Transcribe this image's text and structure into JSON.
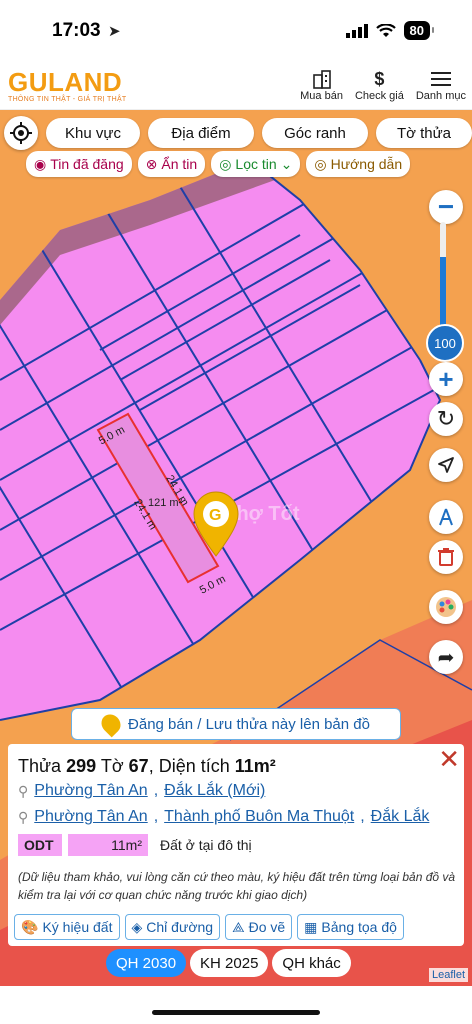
{
  "status": {
    "time": "17:03",
    "battery": "80"
  },
  "header": {
    "logo": "GULAND",
    "tagline": "THÔNG TIN THẬT - GIÁ TRỊ THẬT",
    "nav": [
      {
        "label": "Mua bán",
        "icon": "building-icon"
      },
      {
        "label": "Check giá",
        "icon": "dollar-icon"
      },
      {
        "label": "Danh mục",
        "icon": "menu-icon"
      }
    ]
  },
  "filters": [
    "Khu vực",
    "Địa điểm",
    "Góc ranh",
    "Tờ thửa"
  ],
  "chips": [
    "Tin đã đăng",
    "Ẩn tin",
    "Lọc tin",
    "Hướng dẫn"
  ],
  "map": {
    "zoom": "100",
    "edge_top": "5.0 m",
    "edge_bottom": "5.0 m",
    "edge_right": "24.1 m",
    "edge_left": "24.1 m",
    "area_label": "121 m²",
    "watermark": "Chợ Tốt",
    "colors": {
      "land_pink": "#f58cf0",
      "orange": "#f4a14f",
      "road_red": "#e8534a",
      "grid_blue": "#1e3fa8"
    }
  },
  "banner": "Đăng bán / Lưu thửa này lên bản đồ",
  "panel": {
    "title_prefix": "Thửa",
    "parcel": "299",
    "sheet_label": "Tờ",
    "sheet": "67",
    "area_label": ", Diện tích",
    "area": "11m²",
    "addr1": [
      "Phường Tân An",
      "Đắk Lắk (Mới)"
    ],
    "addr2": [
      "Phường Tân An",
      "Thành phố Buôn Ma Thuột",
      "Đắk Lắk"
    ],
    "land_code": "ODT",
    "land_area": "11m²",
    "land_desc": "Đất ở tại đô thị",
    "note": "(Dữ liệu tham khảo, vui lòng căn cứ theo màu, ký hiệu đất trên từng loại bản đồ và kiểm tra lại với cơ quan chức năng trước khi giao dịch)",
    "actions": [
      "Ký hiệu đất",
      "Chỉ đường",
      "Đo vẽ",
      "Bảng tọa độ"
    ]
  },
  "tabs": [
    "QH 2030",
    "KH 2025",
    "QH khác"
  ],
  "attribution": "Leaflet"
}
